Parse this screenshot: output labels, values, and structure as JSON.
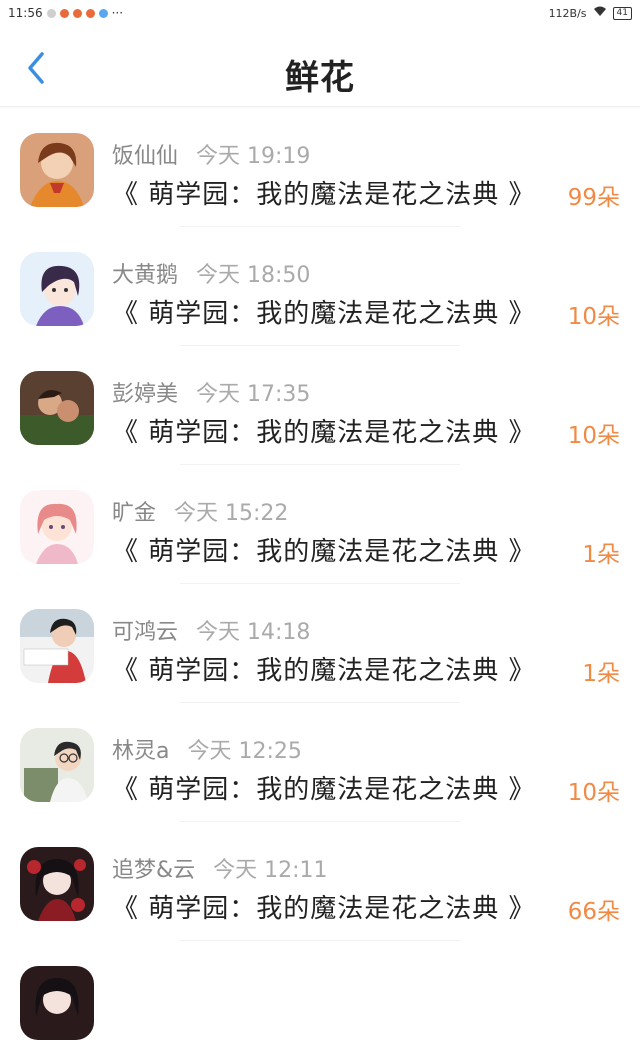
{
  "status_bar": {
    "time": "11:56",
    "more": "···",
    "net_speed": "112B/s",
    "battery": "41"
  },
  "nav": {
    "title": "鲜花",
    "back_icon": "chevron-left-icon",
    "accent_color": "#3b8fe0"
  },
  "entries": [
    {
      "name": "饭仙仙",
      "time": "今天 19:19",
      "book": "《 萌学园：我的魔法是花之法典 》",
      "amount": "99朵"
    },
    {
      "name": "大黄鹅",
      "time": "今天 18:50",
      "book": "《 萌学园：我的魔法是花之法典 》",
      "amount": "10朵"
    },
    {
      "name": "彭婷美",
      "time": "今天 17:35",
      "book": "《 萌学园：我的魔法是花之法典 》",
      "amount": "10朵"
    },
    {
      "name": "旷金",
      "time": "今天 15:22",
      "book": "《 萌学园：我的魔法是花之法典 》",
      "amount": "1朵"
    },
    {
      "name": "可鸿云",
      "time": "今天 14:18",
      "book": "《 萌学园：我的魔法是花之法典 》",
      "amount": "1朵"
    },
    {
      "name": "林灵a",
      "time": "今天 12:25",
      "book": "《 萌学园：我的魔法是花之法典 》",
      "amount": "10朵"
    },
    {
      "name": "追梦&云",
      "time": "今天 12:11",
      "book": "《 萌学园：我的魔法是花之法典 》",
      "amount": "66朵"
    }
  ],
  "colors": {
    "amount": "#f08a44",
    "name": "#888888",
    "time": "#aaaaaa"
  }
}
